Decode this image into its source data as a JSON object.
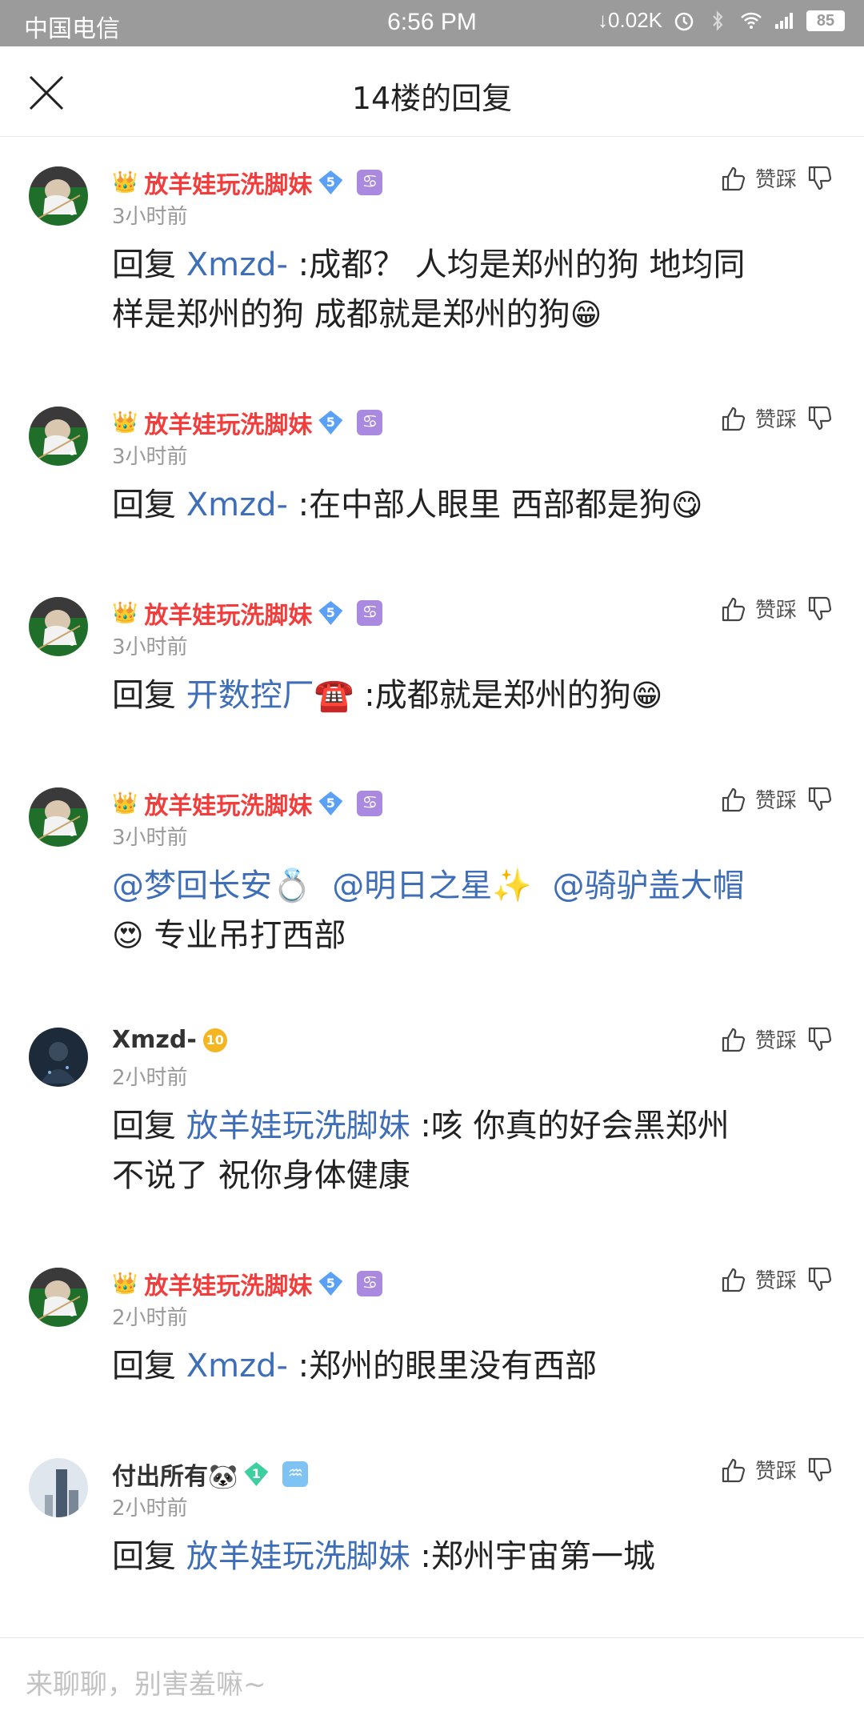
{
  "status_bar": {
    "carrier": "中国电信",
    "time": "6:56 PM",
    "net_speed": "↓0.02K",
    "battery": "85"
  },
  "header": {
    "title": "14楼的回复"
  },
  "action_labels": {
    "like_dislike": "赞踩"
  },
  "replies": [
    {
      "username": "放羊娃玩洗脚妹",
      "level": "5",
      "time": "3小时前",
      "prefix": "回复 ",
      "mention": "Xmzd-",
      "line1": " :成都？ 人均是郑州的狗 地均同",
      "line2": "样是郑州的狗 成都就是郑州的狗",
      "emoji": "😁"
    },
    {
      "username": "放羊娃玩洗脚妹",
      "level": "5",
      "time": "3小时前",
      "prefix": "回复 ",
      "mention": "Xmzd-",
      "line1": " :在中部人眼里 西部都是狗",
      "emoji": "😋"
    },
    {
      "username": "放羊娃玩洗脚妹",
      "level": "5",
      "time": "3小时前",
      "prefix": "回复 ",
      "mention": "开数控厂☎️",
      "line1": " :成都就是郑州的狗",
      "emoji": "😁"
    },
    {
      "username": "放羊娃玩洗脚妹",
      "level": "5",
      "time": "3小时前",
      "mention1": "@梦回长安💍",
      "mention2": "@明日之星✨",
      "mention3": "@骑驴盖大帽",
      "emoji": "😍",
      "line2": " 专业吊打西部"
    },
    {
      "username": "Xmzd-",
      "level": "10",
      "time": "2小时前",
      "prefix": "回复 ",
      "mention": "放羊娃玩洗脚妹",
      "line1": " :咳 你真的好会黑郑州",
      "line2": "不说了 祝你身体健康"
    },
    {
      "username": "放羊娃玩洗脚妹",
      "level": "5",
      "time": "2小时前",
      "prefix": "回复 ",
      "mention": "Xmzd-",
      "line1": " :郑州的眼里没有西部"
    },
    {
      "username": "付出所有🐼",
      "level": "1",
      "time": "2小时前",
      "prefix": "回复 ",
      "mention": "放羊娃玩洗脚妹",
      "line1": " :郑州宇宙第一城"
    }
  ],
  "input": {
    "placeholder": "来聊聊，别害羞嘛~"
  },
  "icons": {
    "crown": "crown-icon",
    "diamond": "diamond-level-icon",
    "cancer_sign": "♋",
    "aquarius_sign": "♒"
  },
  "colors": {
    "status_bar_bg": "#9b9b9b",
    "vip_name": "#f33d3d",
    "mention": "#3f6eb8",
    "timestamp": "#999999"
  }
}
